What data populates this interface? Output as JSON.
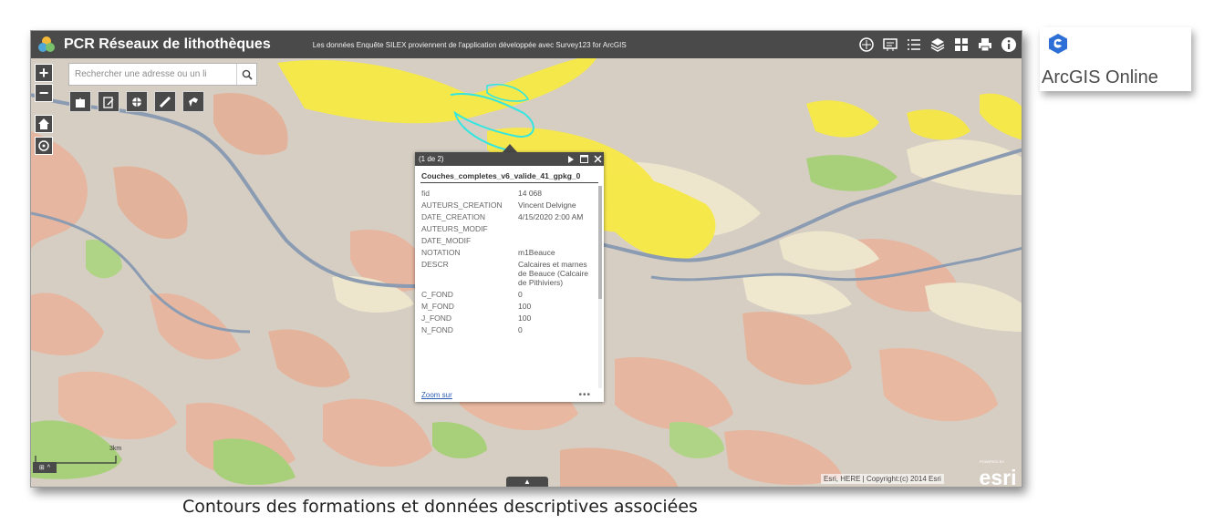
{
  "header": {
    "title": "PCR Réseaux de lithothèques",
    "subtitle": "Les données Enquête SILEX proviennent de l'application développée avec Survey123 for ArcGIS",
    "tools": [
      "basemap-gallery-icon",
      "legend-icon",
      "layer-list-icon",
      "layers-icon",
      "grid-icon",
      "print-icon",
      "about-icon"
    ]
  },
  "map_controls": {
    "zoom_in": "+",
    "zoom_out": "−",
    "home_icon": "home-icon",
    "locate_icon": "locate-icon"
  },
  "search": {
    "placeholder": "Rechercher une adresse ou un li"
  },
  "widgets": [
    "bookmark-icon",
    "edit-icon",
    "attribute-icon",
    "measure-icon",
    "share-icon"
  ],
  "popup": {
    "counter": "(1 de 2)",
    "layer_title": "Couches_completes_v6_valide_41_gpkg_0",
    "attributes": [
      {
        "key": "fid",
        "value": "14 068"
      },
      {
        "key": "AUTEURS_CREATION",
        "value": "Vincent Delvigne"
      },
      {
        "key": "DATE_CREATION",
        "value": "4/15/2020 2:00 AM"
      },
      {
        "key": "AUTEURS_MODIF",
        "value": ""
      },
      {
        "key": "DATE_MODIF",
        "value": ""
      },
      {
        "key": "NOTATION",
        "value": "m1Beauce"
      },
      {
        "key": "DESCR",
        "value": "Calcaires et marnes de Beauce (Calcaire de Pithiviers)"
      },
      {
        "key": "C_FOND",
        "value": "0"
      },
      {
        "key": "M_FOND",
        "value": "100"
      },
      {
        "key": "J_FOND",
        "value": "100"
      },
      {
        "key": "N_FOND",
        "value": "0"
      }
    ],
    "zoom_link": "Zoom sur",
    "more": "•••"
  },
  "scale": {
    "label": "3km"
  },
  "attribution": "Esri, HERE | Copyright:(c) 2014 Esri",
  "esri_logo": "esri",
  "esri_powered": "POWERED BY",
  "badge": {
    "text": "ArcGIS Online"
  },
  "caption": "Contours des formations et données descriptives associées",
  "colors": {
    "header_bg": "#4a4a4a",
    "geology_yellow": "#f5e84a",
    "geology_salmon": "#e8b49a",
    "geology_cream": "#eee6cc",
    "geology_green": "#a8cf7a",
    "river": "#8e9fb5",
    "selection_cyan": "#33e6e0"
  }
}
